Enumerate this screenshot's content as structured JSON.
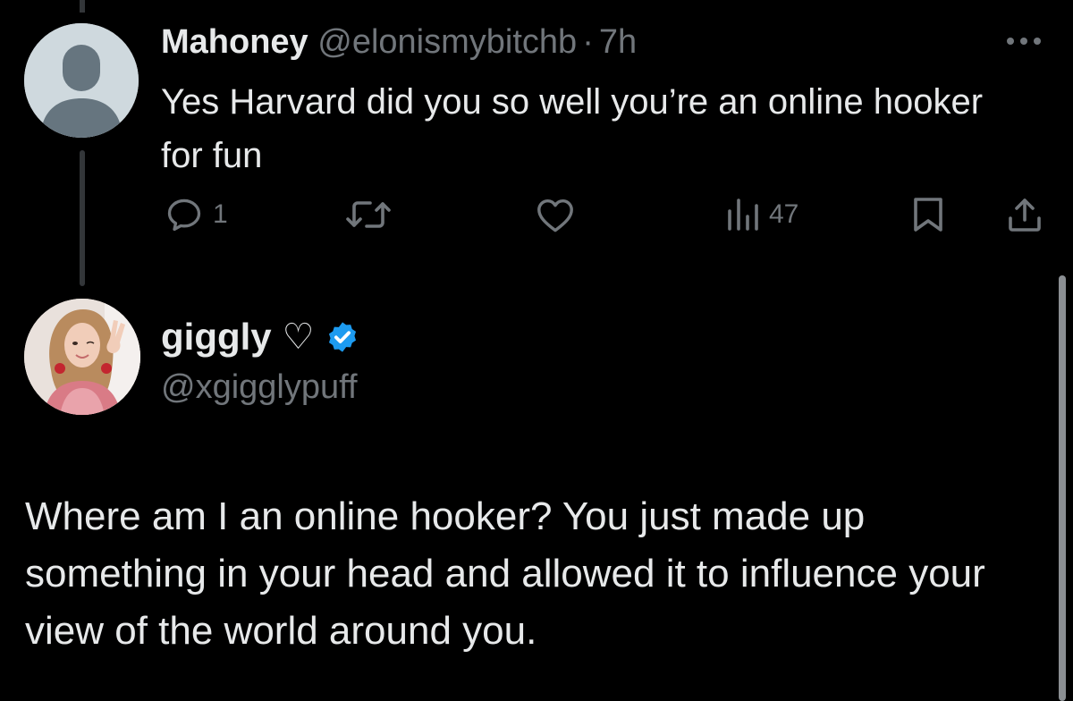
{
  "reply": {
    "name": "Mahoney",
    "handle": "@elonismybitchb",
    "separator": "·",
    "time": "7h",
    "text": "Yes Harvard did you so well you’re an online hooker for fun",
    "actions": {
      "reply_icon": "comment-icon",
      "reply_count": "1",
      "retweet_icon": "retweet-icon",
      "like_icon": "heart-icon",
      "views_icon": "views-chart-icon",
      "views_count": "47",
      "bookmark_icon": "bookmark-icon",
      "share_icon": "share-icon"
    },
    "more_icon": "more-dots-icon"
  },
  "main": {
    "name": "giggly",
    "name_symbol": "♡",
    "verified_icon": "verified-badge-icon",
    "handle": "@xgigglypuff",
    "text": "Where am I an online hooker? You just made up something in your head and allowed it to influence your view of the world around you."
  },
  "colors": {
    "background": "#000000",
    "text": "#e7e9ea",
    "muted": "#71767b",
    "verified": "#1d9bf0"
  }
}
